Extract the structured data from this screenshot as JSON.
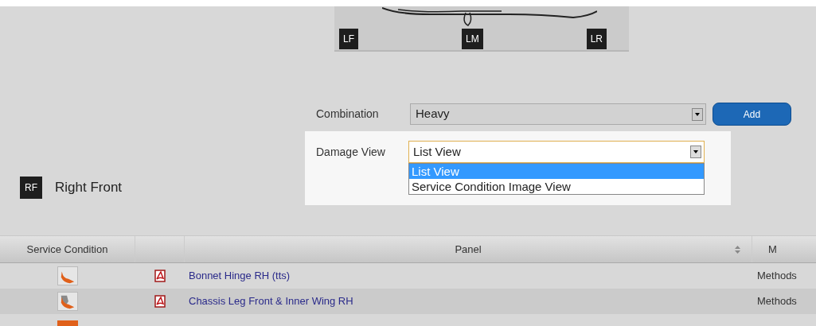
{
  "diagram": {
    "markers": [
      "LF",
      "LM",
      "LR"
    ]
  },
  "combination": {
    "label": "Combination",
    "value": "Heavy",
    "button": "Add"
  },
  "damage_view": {
    "label": "Damage View",
    "value": "List View",
    "options": [
      {
        "label": "List View",
        "selected": true
      },
      {
        "label": "Service Condition Image View",
        "selected": false
      }
    ]
  },
  "section": {
    "badge": "RF",
    "title": "Right Front"
  },
  "table": {
    "columns": [
      "Service Condition",
      "Panel",
      "M"
    ],
    "rows": [
      {
        "kind": "orange",
        "panel": "Bonnet Hinge RH (tts)",
        "method": "Methods"
      },
      {
        "kind": "grey",
        "panel": "Chassis Leg Front & Inner Wing RH",
        "method": "Methods"
      }
    ]
  }
}
